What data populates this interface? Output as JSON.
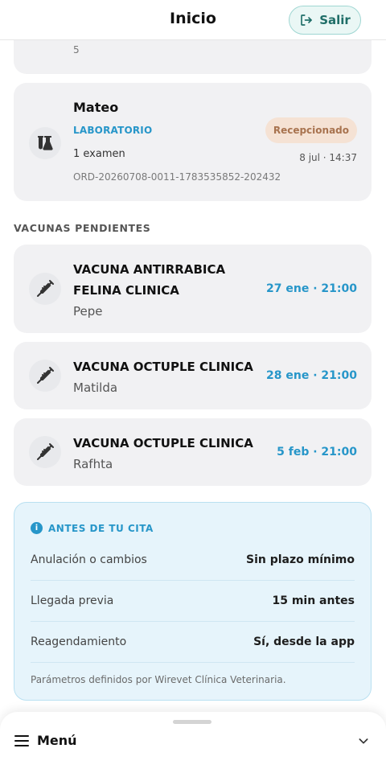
{
  "header": {
    "title": "Inicio",
    "logout_label": "Salir"
  },
  "partial_card": {
    "value": "5"
  },
  "lab_order": {
    "pet_name": "Mateo",
    "category": "LABORATORIO",
    "exam_count": "1 examen",
    "order_id": "ORD-20260708-0011-1783535852-202432",
    "status": "Recepcionado",
    "datetime": "8 jul · 14:37",
    "icon": "lab-flasks-icon"
  },
  "vaccines": {
    "section_title": "VACUNAS PENDIENTES",
    "items": [
      {
        "name": "VACUNA ANTIRRABICA FELINA CLINICA",
        "pet": "Pepe",
        "when": "27 ene · 21:00",
        "icon": "syringe-icon"
      },
      {
        "name": "VACUNA OCTUPLE CLINICA",
        "pet": "Matilda",
        "when": "28 ene · 21:00",
        "icon": "syringe-icon"
      },
      {
        "name": "VACUNA OCTUPLE CLINICA",
        "pet": "Rafhta",
        "when": "5 feb · 21:00",
        "icon": "syringe-icon"
      }
    ]
  },
  "before_appointment": {
    "title": "ANTES DE TU CITA",
    "rows": [
      {
        "label": "Anulación o cambios",
        "value": "Sin plazo mínimo"
      },
      {
        "label": "Llegada previa",
        "value": "15 min antes"
      },
      {
        "label": "Reagendamiento",
        "value": "Sí, desde la app"
      }
    ],
    "footer": "Parámetros definidos por Wirevet Clínica Veterinaria."
  },
  "bottom_menu": {
    "label": "Menú"
  },
  "colors": {
    "accent_blue": "#2796c9",
    "teal": "#1f6e68",
    "badge_bg": "#f5e2d4",
    "badge_text": "#a8734f"
  }
}
